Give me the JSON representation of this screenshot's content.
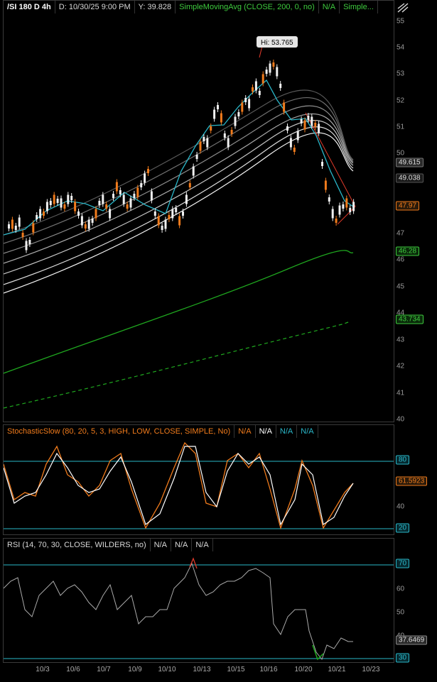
{
  "price_panel": {
    "symbol": "/SI 180 D 4h",
    "date": "D: 10/30/25 9:00 PM",
    "y": "Y: 39.828",
    "study": "SimpleMovingAvg (CLOSE, 200, 0, no)",
    "na": "N/A",
    "study2": "Simple...",
    "hi_label": "Hi: 53.765",
    "ticks": [
      "55",
      "54",
      "53",
      "52",
      "51",
      "50",
      "48",
      "47",
      "46",
      "45",
      "44",
      "43",
      "42",
      "41",
      "40"
    ],
    "tags": [
      "49.615",
      "49.038",
      "47.97",
      "46.28",
      "43.734"
    ]
  },
  "stoch_panel": {
    "title": "StochasticSlow (80, 20, 5, 3, HIGH, LOW, CLOSE, SIMPLE, No)",
    "na1": "N/A",
    "na2": "N/A",
    "na3": "N/A",
    "na4": "N/A",
    "ticks": [
      "40"
    ],
    "tag80": "80",
    "tag20": "20",
    "tagval": "61.5923"
  },
  "rsi_panel": {
    "title": "RSI (14, 70, 30, CLOSE, WILDERS, no)",
    "na1": "N/A",
    "na2": "N/A",
    "na3": "N/A",
    "ticks": [
      "60",
      "50",
      "40"
    ],
    "tag70": "70",
    "tag30": "30",
    "tagval": "37.6469"
  },
  "x_axis": [
    "10/3",
    "10/6",
    "10/7",
    "10/9",
    "10/10",
    "10/13",
    "10/15",
    "10/16",
    "10/20",
    "10/21",
    "10/23"
  ],
  "chart_data": {
    "type": "line",
    "ylim": [
      40,
      55
    ],
    "title": "/SI 180 D 4h",
    "series": [
      {
        "name": "SimpleMovingAvg (CLOSE, 200, 0, no)",
        "values": [
          41.8,
          42.6,
          43.5,
          44.4,
          45.2,
          45.9,
          46.28
        ]
      }
    ]
  },
  "colors": {
    "up": "#f0f0f0",
    "down": "#f07b1c",
    "sma200": "#1fa81f",
    "ema": "#2ab7c9",
    "stochK": "#f07b1c",
    "stochD": "#ffffff"
  }
}
